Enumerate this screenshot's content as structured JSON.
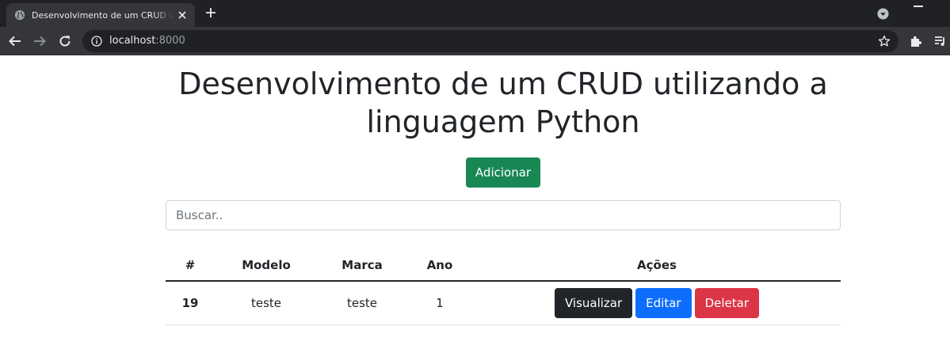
{
  "browser": {
    "tab_title": "Desenvolvimento de um CRUD utilizando a linguagem Python",
    "url_host": "localhost",
    "url_port": ":8000"
  },
  "page": {
    "title": "Desenvolvimento de um CRUD utilizando a linguagem Python",
    "add_label": "Adicionar",
    "search_placeholder": "Buscar.."
  },
  "table": {
    "headers": [
      "#",
      "Modelo",
      "Marca",
      "Ano",
      "Ações"
    ],
    "rows": [
      {
        "id": "19",
        "modelo": "teste",
        "marca": "teste",
        "ano": "1"
      }
    ],
    "actions": {
      "view": "Visualizar",
      "edit": "Editar",
      "delete": "Deletar"
    }
  },
  "colors": {
    "success": "#198754",
    "primary": "#0d6efd",
    "danger": "#dc3545",
    "dark": "#212529"
  },
  "icons": [
    "globe-icon",
    "close-icon",
    "plus-icon",
    "chevron-down-icon",
    "back-arrow-icon",
    "forward-arrow-icon",
    "reload-icon",
    "info-icon",
    "star-icon",
    "puzzle-icon",
    "media-icon"
  ]
}
